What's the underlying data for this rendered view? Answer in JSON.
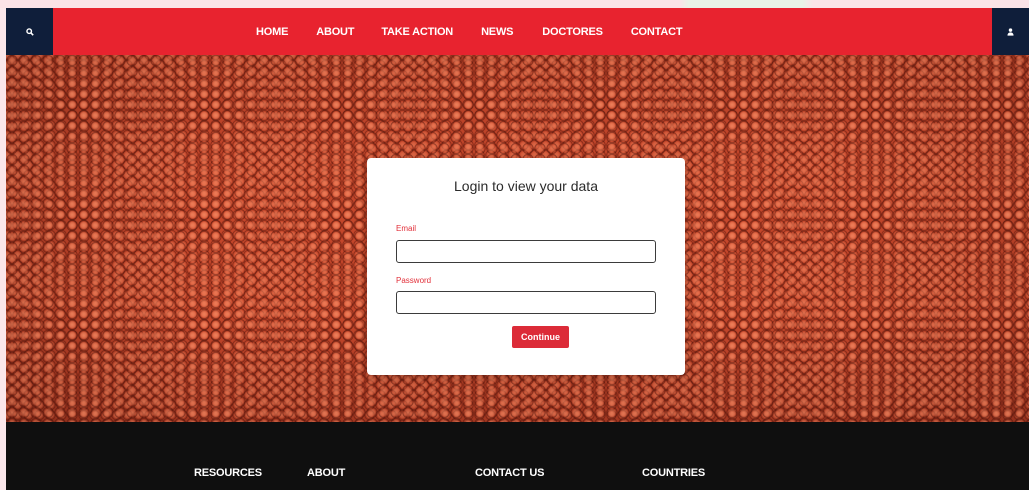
{
  "nav": {
    "links": [
      "HOME",
      "ABOUT",
      "TAKE ACTION",
      "NEWS",
      "DOCTORES",
      "CONTACT"
    ],
    "search_icon": "search-icon",
    "user_icon": "user-icon"
  },
  "hero": {
    "background": "basketball-leather-texture"
  },
  "login": {
    "title": "Login to view your data",
    "email_label": "Email",
    "email_value": "",
    "password_label": "Password",
    "password_value": "",
    "continue_label": "Continue"
  },
  "footer": {
    "headings": [
      "RESOURCES",
      "ABOUT",
      "CONTACT US",
      "COUNTRIES"
    ]
  },
  "colors": {
    "nav_red": "#e8232f",
    "nav_dark": "#0f1e3a",
    "button_red": "#dc2b38",
    "footer_bg": "#0f0f0f"
  }
}
